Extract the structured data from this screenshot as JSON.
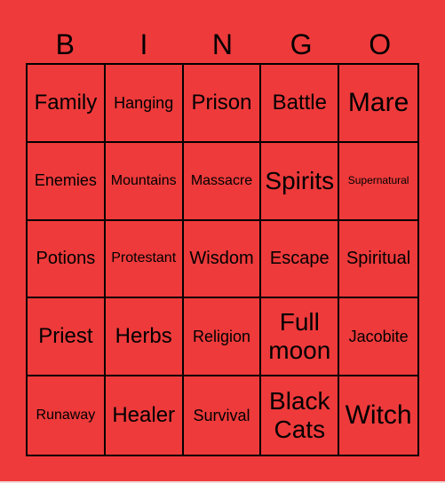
{
  "header": [
    "B",
    "I",
    "N",
    "G",
    "O"
  ],
  "colors": {
    "background": "#ee3a3b",
    "grid_line": "#000000",
    "text": "#000000"
  },
  "cells": [
    {
      "text": "Family",
      "size": "s5"
    },
    {
      "text": "Hanging",
      "size": "s3"
    },
    {
      "text": "Prison",
      "size": "s5"
    },
    {
      "text": "Battle",
      "size": "s5"
    },
    {
      "text": "Mare",
      "size": "s7"
    },
    {
      "text": "Enemies",
      "size": "s3"
    },
    {
      "text": "Mountains",
      "size": "s2"
    },
    {
      "text": "Massacre",
      "size": "s2"
    },
    {
      "text": "Spirits",
      "size": "s6"
    },
    {
      "text": "Supernatural",
      "size": "s1"
    },
    {
      "text": "Potions",
      "size": "s4"
    },
    {
      "text": "Protestant",
      "size": "s2"
    },
    {
      "text": "Wisdom",
      "size": "s4"
    },
    {
      "text": "Escape",
      "size": "s4"
    },
    {
      "text": "Spiritual",
      "size": "s4"
    },
    {
      "text": "Priest",
      "size": "s5"
    },
    {
      "text": "Herbs",
      "size": "s5"
    },
    {
      "text": "Religion",
      "size": "s3"
    },
    {
      "text": "Full moon",
      "size": "s6"
    },
    {
      "text": "Jacobite",
      "size": "s3"
    },
    {
      "text": "Runaway",
      "size": "s2"
    },
    {
      "text": "Healer",
      "size": "s5"
    },
    {
      "text": "Survival",
      "size": "s3"
    },
    {
      "text": "Black Cats",
      "size": "s6"
    },
    {
      "text": "Witch",
      "size": "s7"
    }
  ]
}
